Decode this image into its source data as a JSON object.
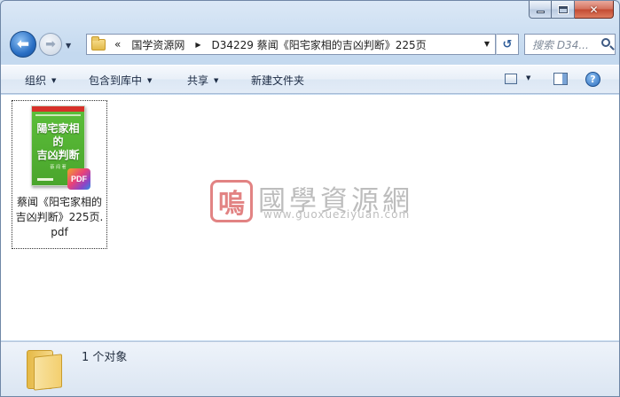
{
  "window": {
    "caption_close_glyph": "✕"
  },
  "nav": {
    "back_glyph": "⬅",
    "forward_glyph": "➡",
    "breadcrumb_chevron": "«",
    "breadcrumb": [
      {
        "label": "国学资源网"
      },
      {
        "label": "D34229 蔡闻《阳宅家相的吉凶判断》225页"
      }
    ],
    "refresh_glyph": "↺",
    "search_placeholder": "搜索 D34..."
  },
  "toolbar": {
    "organize": "组织",
    "include_in_library": "包含到库中",
    "share": "共享",
    "new_folder": "新建文件夹",
    "help_glyph": "?"
  },
  "file": {
    "name": "蔡闻《阳宅家相的吉凶判断》225页.pdf",
    "thumbnail_title": "陽宅家相\n的\n吉凶判断",
    "thumbnail_author": "蔡 闻 著",
    "badge": "PDF"
  },
  "watermark": {
    "seal": "嗚",
    "title": "國學資源網",
    "url": "www.guoxueziyuan.com"
  },
  "status": {
    "count_text": "1 个对象"
  },
  "colors": {
    "window_frame": "#6f87a6",
    "toolbar_bg": "#e3ecf7",
    "close_button": "#c34a32",
    "book_cover_green": "#4aa52c",
    "watermark_red": "#d95a5a"
  }
}
